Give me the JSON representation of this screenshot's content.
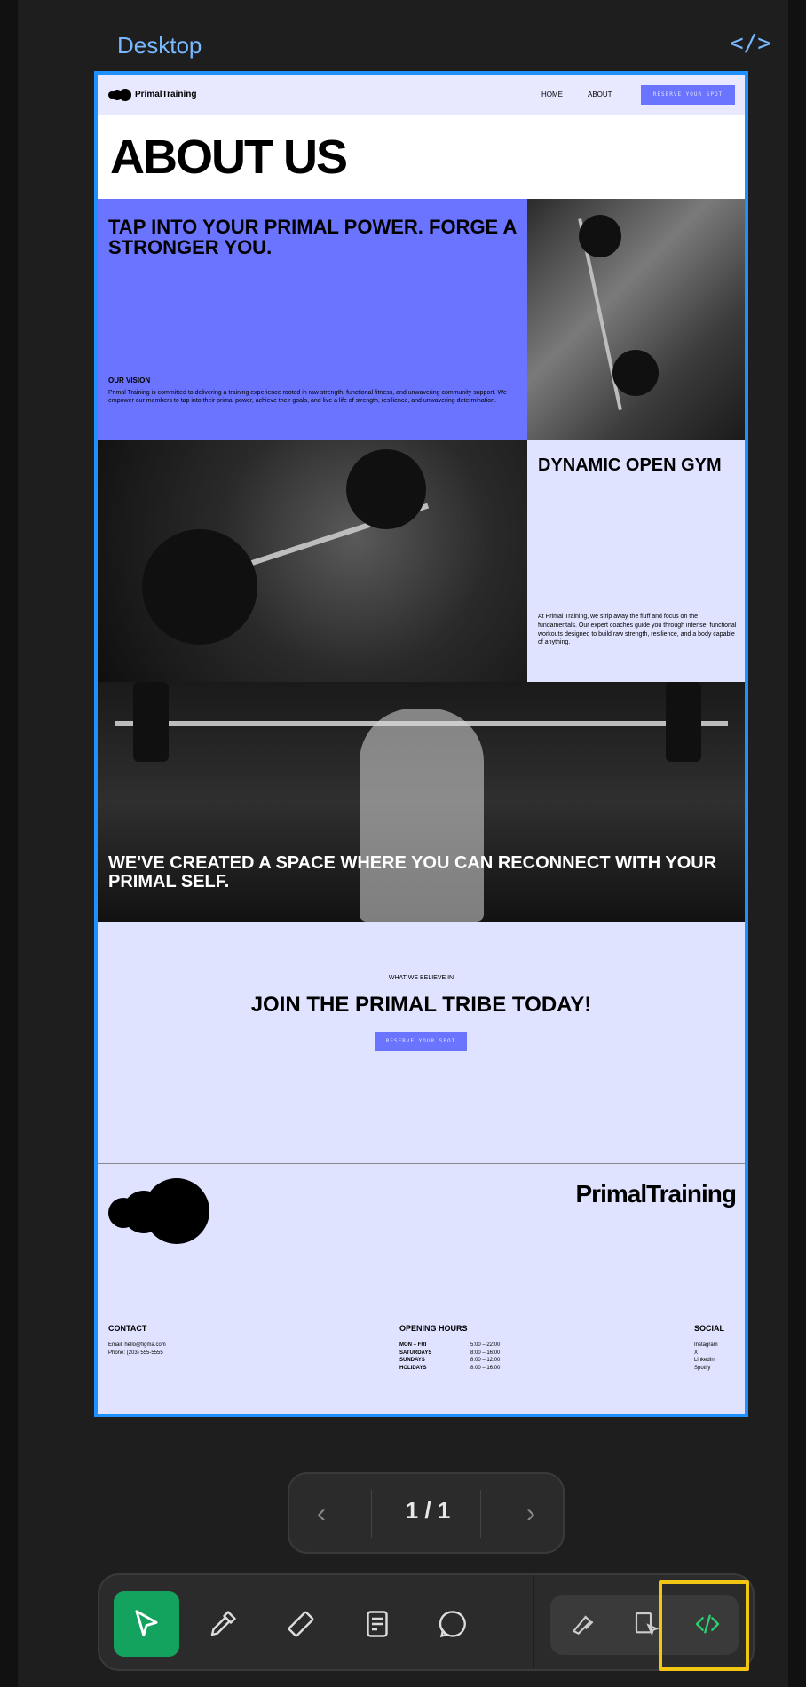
{
  "frame": {
    "title": "Desktop",
    "code_icon_text": "</>"
  },
  "site": {
    "brand": "PrimalTraining",
    "nav": {
      "home": "HOME",
      "about": "ABOUT",
      "cta": "RESERVE YOUR SPOT"
    },
    "hero_title": "ABOUT US",
    "headline": "TAP INTO YOUR PRIMAL POWER. FORGE A STRONGER YOU.",
    "vision": {
      "heading": "OUR VISION",
      "text": "Primal Training is committed to delivering a training experience rooted in raw strength, functional fitness, and unwavering community support. We empower our members to tap into their primal power, achieve their goals, and live a life of strength, resilience, and unwavering determination."
    },
    "gym": {
      "heading": "DYNAMIC OPEN GYM",
      "text": "At Primal Training, we strip away the fluff and focus on the fundamentals. Our expert coaches guide you through intense, functional workouts designed to build raw strength, resilience, and a body capable of anything."
    },
    "space_caption": "WE'VE CREATED A SPACE WHERE YOU CAN RECONNECT WITH YOUR PRIMAL SELF.",
    "tribe": {
      "eyebrow": "WHAT WE BELIEVE IN",
      "heading": "JOIN THE PRIMAL TRIBE TODAY!",
      "cta": "RESERVE YOUR SPOT"
    },
    "footer": {
      "brand": "PrimalTraining",
      "contact": {
        "heading": "CONTACT",
        "email": "Email: hello@figma.com",
        "phone": "Phone: (203) 555-5555"
      },
      "hours": {
        "heading": "OPENING HOURS",
        "rows": [
          {
            "day": "MON – FRI",
            "time": "5:00 – 22:00"
          },
          {
            "day": "SATURDAYS",
            "time": "8:00 – 16:00"
          },
          {
            "day": "SUNDAYS",
            "time": "8:00 – 12:00"
          },
          {
            "day": "HOLIDAYS",
            "time": "8:00 – 16:00"
          }
        ]
      },
      "social": {
        "heading": "SOCIAL",
        "items": [
          "Instagram",
          "X",
          "LinkedIn",
          "Spotify"
        ]
      }
    }
  },
  "pager": {
    "label": "1 / 1",
    "prev_icon": "chevron-left",
    "next_icon": "chevron-right"
  },
  "toolbar": {
    "tools": [
      "pointer",
      "eyedropper",
      "ruler",
      "annotate",
      "comment"
    ],
    "modes": [
      "draw",
      "inspect",
      "code"
    ],
    "active_tool": "pointer",
    "highlighted_mode": "code",
    "accent": "#13a35e",
    "highlight_color": "#f3c614"
  }
}
